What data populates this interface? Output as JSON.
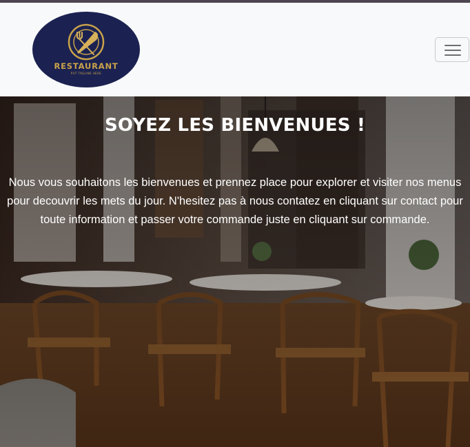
{
  "navbar": {
    "logo": {
      "brand_text": "RESTAURANT",
      "tagline": "PUT TAGLINE HERE",
      "icon": "plate-fork-knife-icon",
      "colors": {
        "background": "#1b2251",
        "accent": "#c9a24a"
      }
    },
    "toggler_icon": "hamburger-menu-icon"
  },
  "hero": {
    "title": "SOYEZ LES BIENVENUES !",
    "text": "Nous vous souhaitons les bienvenues et prennez place pour explorer et visiter nos menus pour decouvrir les mets du jour. N'hesitez pas à nous contatez en cliquant sur contact pour toute information et passer votre commande juste en cliquant sur commande."
  },
  "colors": {
    "navbar_bg": "#f8f9fa",
    "hero_text": "#ffffff"
  }
}
